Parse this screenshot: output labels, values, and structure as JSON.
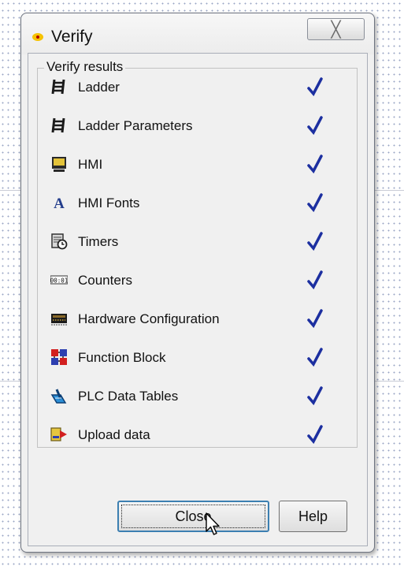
{
  "dialog": {
    "title": "Verify",
    "close_glyph": "╳",
    "group_label": "Verify results",
    "items": [
      {
        "label": "Ladder",
        "icon": "ladder-icon",
        "status": "verified"
      },
      {
        "label": "Ladder Parameters",
        "icon": "ladder-parameters-icon",
        "status": "verified"
      },
      {
        "label": "HMI",
        "icon": "hmi-icon",
        "status": "verified"
      },
      {
        "label": "HMI Fonts",
        "icon": "hmi-fonts-icon",
        "status": "verified"
      },
      {
        "label": "Timers",
        "icon": "timers-icon",
        "status": "verified"
      },
      {
        "label": "Counters",
        "icon": "counters-icon",
        "status": "verified"
      },
      {
        "label": "Hardware Configuration",
        "icon": "hardware-configuration-icon",
        "status": "verified"
      },
      {
        "label": "Function Block",
        "icon": "function-block-icon",
        "status": "verified"
      },
      {
        "label": "PLC Data Tables",
        "icon": "plc-data-tables-icon",
        "status": "verified"
      },
      {
        "label": "Upload data",
        "icon": "upload-data-icon",
        "status": "verified"
      }
    ],
    "counters_icon_text": "00:01",
    "hmi_fonts_icon_text": "A",
    "close_button": "Close",
    "help_button": "Help",
    "colors": {
      "check": "#1c2fa0",
      "focus": "#3c7fb1"
    }
  }
}
